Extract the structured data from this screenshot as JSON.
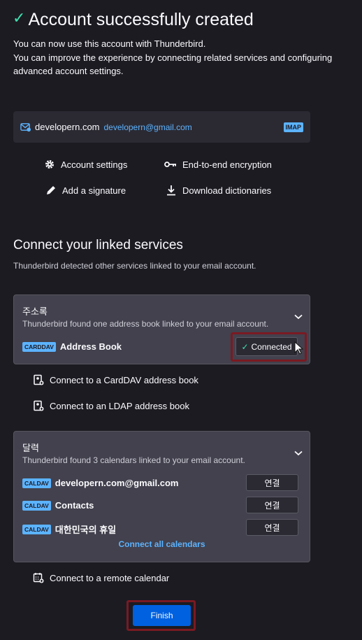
{
  "header": {
    "title": "Account successfully created",
    "line1": "You can now use this account with Thunderbird.",
    "line2": "You can improve the experience by connecting related services and configuring",
    "line3": "advanced account settings."
  },
  "account": {
    "name": "developern.com",
    "email": "developern@gmail.com",
    "protocol": "IMAP"
  },
  "options": {
    "account_settings": "Account settings",
    "encryption": "End-to-end encryption",
    "signature": "Add a signature",
    "dictionaries": "Download dictionaries"
  },
  "linked": {
    "title": "Connect your linked services",
    "description": "Thunderbird detected other services linked to your email account."
  },
  "address_book": {
    "title": "주소록",
    "subtitle": "Thunderbird found one address book linked to your email account.",
    "badge": "CARDDAV",
    "name": "Address Book",
    "button": "Connected"
  },
  "address_links": {
    "carddav": "Connect to a CardDAV address book",
    "ldap": "Connect to an LDAP address book"
  },
  "calendar": {
    "title": "달력",
    "subtitle": "Thunderbird found 3 calendars linked to your email account.",
    "items": [
      {
        "badge": "CALDAV",
        "name": "developern.com@gmail.com",
        "button": "연결"
      },
      {
        "badge": "CALDAV",
        "name": "Contacts",
        "button": "연결"
      },
      {
        "badge": "CALDAV",
        "name": "대한민국의 휴일",
        "button": "연결"
      }
    ],
    "connect_all": "Connect all calendars"
  },
  "remote_calendar": "Connect to a remote calendar",
  "finish": "Finish",
  "colors": {
    "background": "#1c1b22",
    "card": "#42414d",
    "accent": "#5cb3ff",
    "success": "#3fe1b0",
    "primary_button": "#0061e0",
    "highlight": "#7a1a22"
  }
}
